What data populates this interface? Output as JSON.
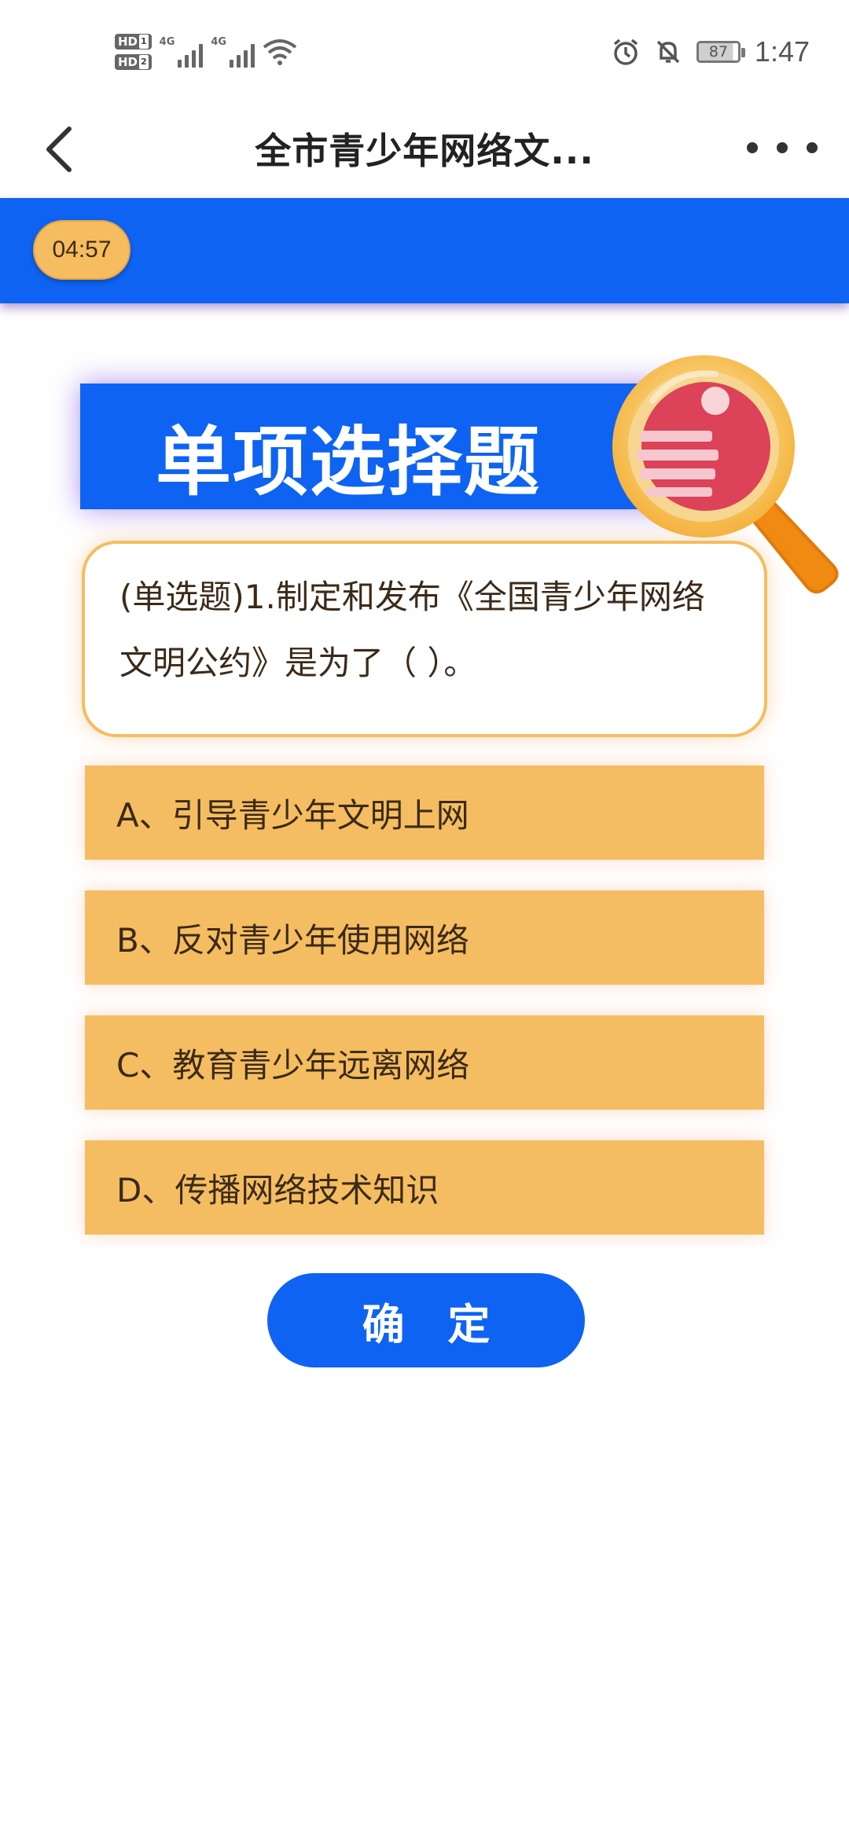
{
  "status_bar": {
    "hd1": "HD",
    "hd1_sub": "1",
    "hd2": "HD",
    "hd2_sub": "2",
    "net1": "4G",
    "net2": "4G",
    "battery": "87",
    "time": "1:47"
  },
  "title_bar": {
    "title": "全市青少年网络文..."
  },
  "timer": "04:57",
  "section": {
    "title": "单项选择题"
  },
  "question": {
    "text": "(单选题)1.制定和发布《全国青少年网络文明公约》是为了（ ）。"
  },
  "options": [
    {
      "label": "A、引导青少年文明上网"
    },
    {
      "label": "B、反对青少年使用网络"
    },
    {
      "label": "C、教育青少年远离网络"
    },
    {
      "label": "D、传播网络技术知识"
    }
  ],
  "confirm_label": "确 定",
  "colors": {
    "primary_blue": "#0e63f2",
    "option_orange": "#f5bd62",
    "text_brown": "#3b2a18"
  }
}
